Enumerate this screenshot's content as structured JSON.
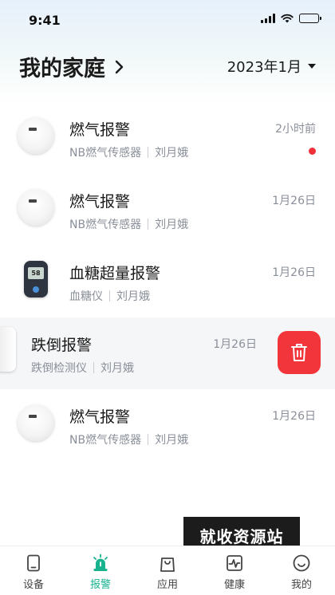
{
  "status_bar": {
    "time": "9:41"
  },
  "header": {
    "home_title": "我的家庭",
    "month": "2023年1月"
  },
  "alerts": [
    {
      "title": "燃气报警",
      "device": "NB燃气传感器",
      "person": "刘月娥",
      "time": "2小时前",
      "unread": true,
      "icon": "smoke-detector"
    },
    {
      "title": "燃气报警",
      "device": "NB燃气传感器",
      "person": "刘月娥",
      "time": "1月26日",
      "unread": false,
      "icon": "smoke-detector"
    },
    {
      "title": "血糖超量报警",
      "device": "血糖仪",
      "person": "刘月娥",
      "time": "1月26日",
      "unread": false,
      "icon": "glucose-meter",
      "meter_reading": "58"
    },
    {
      "title": "跌倒报警",
      "device": "跌倒检测仪",
      "person": "刘月娥",
      "time": "1月26日",
      "unread": false,
      "icon": "fall-detector",
      "swiped": true
    },
    {
      "title": "燃气报警",
      "device": "NB燃气传感器",
      "person": "刘月娥",
      "time": "1月26日",
      "unread": false,
      "icon": "smoke-detector"
    }
  ],
  "watermark": "就收资源站",
  "tabs": [
    {
      "label": "设备",
      "icon": "device-icon",
      "active": false
    },
    {
      "label": "报警",
      "icon": "alarm-icon",
      "active": true
    },
    {
      "label": "应用",
      "icon": "bag-icon",
      "active": false
    },
    {
      "label": "健康",
      "icon": "health-icon",
      "active": false
    },
    {
      "label": "我的",
      "icon": "smile-icon",
      "active": false
    }
  ],
  "colors": {
    "accent": "#19b38f",
    "danger": "#f2353b",
    "unread_dot": "#f0313a",
    "subtext": "#8a8f99"
  }
}
